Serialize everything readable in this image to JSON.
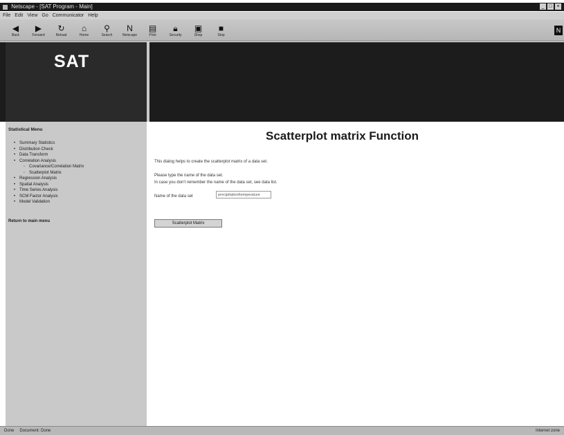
{
  "window": {
    "title": "Netscape - [SAT Program - Main]"
  },
  "menubar": {
    "items": [
      "File",
      "Edit",
      "View",
      "Go",
      "Communicator",
      "Help"
    ]
  },
  "toolbar": {
    "buttons": [
      {
        "label": "Back",
        "icon": "back-arrow-icon"
      },
      {
        "label": "Forward",
        "icon": "forward-arrow-icon"
      },
      {
        "label": "Reload",
        "icon": "reload-icon"
      },
      {
        "label": "Home",
        "icon": "home-icon"
      },
      {
        "label": "Search",
        "icon": "search-icon"
      },
      {
        "label": "Netscape",
        "icon": "netscape-icon"
      },
      {
        "label": "Print",
        "icon": "print-icon"
      },
      {
        "label": "Security",
        "icon": "lock-icon"
      },
      {
        "label": "Shop",
        "icon": "shop-icon"
      },
      {
        "label": "Stop",
        "icon": "stop-icon"
      }
    ]
  },
  "banner": {
    "logo": "SAT"
  },
  "sidebar": {
    "heading": "Statistical Menu",
    "items": [
      {
        "label": "Summary Statistics",
        "level": 1
      },
      {
        "label": "Distribution Check",
        "level": 1
      },
      {
        "label": "Data Transform",
        "level": 1
      },
      {
        "label": "Correlation Analysis",
        "level": 1
      },
      {
        "label": "Covariance/Correlation Matrix",
        "level": 2
      },
      {
        "label": "Scatterplot Matrix",
        "level": 2
      },
      {
        "label": "Regression Analysis",
        "level": 1
      },
      {
        "label": "Spatial Analysis",
        "level": 1
      },
      {
        "label": "Time Series Analysis",
        "level": 1
      },
      {
        "label": "SCM Factor Analysis",
        "level": 1
      },
      {
        "label": "Model Validation",
        "level": 1
      }
    ],
    "footer_link": "Return to main menu"
  },
  "main": {
    "title": "Scatterplot matrix Function",
    "intro": "This dialog helps to create the scatterplot matrix of a data set.",
    "instruction_1": "Please type the name of the data set.",
    "instruction_2": "In case you don't remember the name of the data set, see data list.",
    "field_label": "Name of the data set",
    "field_value": "precipitation/temperature",
    "submit_label": "Scatterplot Matrix"
  },
  "statusbar": {
    "left": "Done",
    "mid": "Document: Done",
    "right": "Internet zone"
  }
}
